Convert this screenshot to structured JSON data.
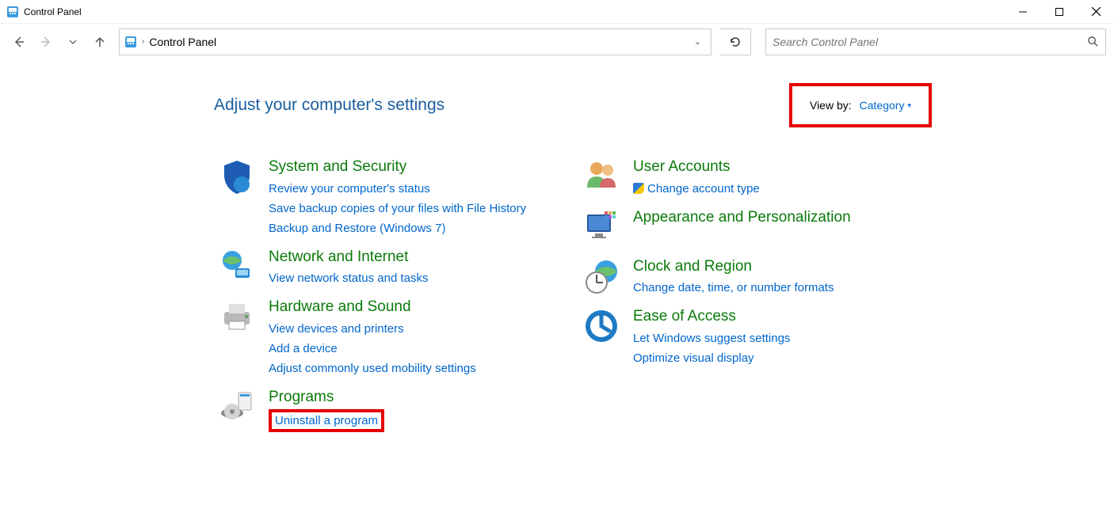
{
  "window": {
    "title": "Control Panel"
  },
  "address": {
    "location": "Control Panel"
  },
  "search": {
    "placeholder": "Search Control Panel"
  },
  "header": {
    "heading": "Adjust your computer's settings",
    "view_by_label": "View by:",
    "view_by_value": "Category"
  },
  "left_col": [
    {
      "title": "System and Security",
      "links": [
        "Review your computer's status",
        "Save backup copies of your files with File History",
        "Backup and Restore (Windows 7)"
      ],
      "shield": [
        false,
        false,
        false
      ]
    },
    {
      "title": "Network and Internet",
      "links": [
        "View network status and tasks"
      ],
      "shield": [
        false
      ]
    },
    {
      "title": "Hardware and Sound",
      "links": [
        "View devices and printers",
        "Add a device",
        "Adjust commonly used mobility settings"
      ],
      "shield": [
        false,
        false,
        false
      ]
    },
    {
      "title": "Programs",
      "links": [
        "Uninstall a program"
      ],
      "highlight": [
        true
      ],
      "shield": [
        false
      ]
    }
  ],
  "right_col": [
    {
      "title": "User Accounts",
      "links": [
        "Change account type"
      ],
      "shield": [
        true
      ]
    },
    {
      "title": "Appearance and Personalization",
      "links": [],
      "shield": []
    },
    {
      "title": "Clock and Region",
      "links": [
        "Change date, time, or number formats"
      ],
      "shield": [
        false
      ]
    },
    {
      "title": "Ease of Access",
      "links": [
        "Let Windows suggest settings",
        "Optimize visual display"
      ],
      "shield": [
        false,
        false
      ]
    }
  ]
}
